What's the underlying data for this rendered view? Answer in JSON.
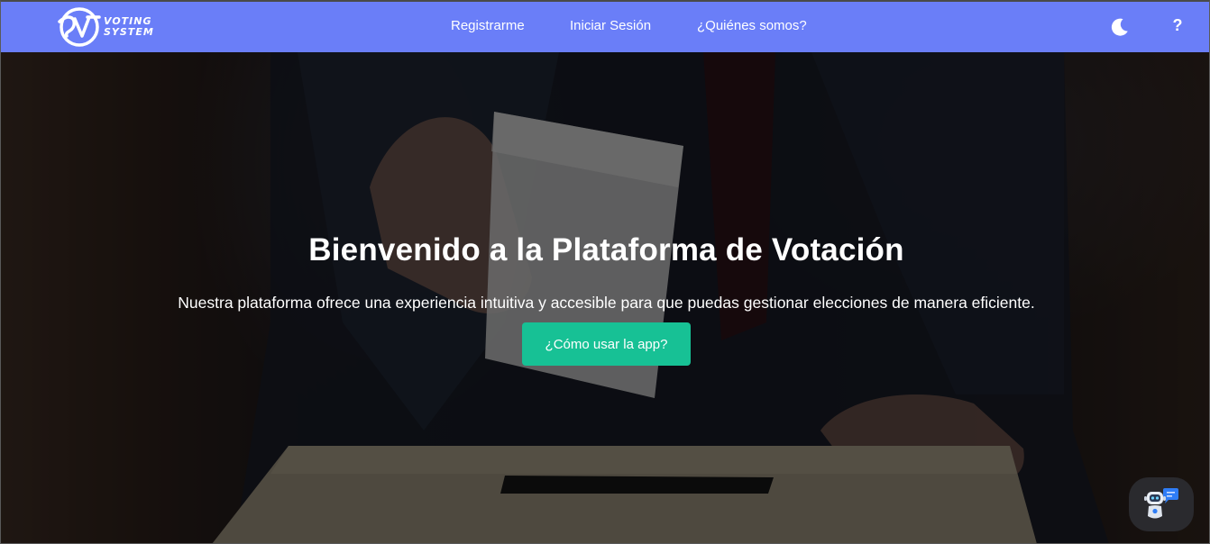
{
  "brand": {
    "logo_letter": "SV",
    "line1": "VOTING",
    "line2": "SYSTEM"
  },
  "nav": {
    "links": [
      {
        "label": "Registrarme"
      },
      {
        "label": "Iniciar Sesión"
      },
      {
        "label": "¿Quiénes somos?"
      }
    ],
    "theme_icon": "moon-icon",
    "help_label": "?"
  },
  "hero": {
    "title": "Bienvenido a la Plataforma de Votación",
    "subtitle": "Nuestra plataforma ofrece una experiencia intuitiva y accesible para que puedas gestionar elecciones de manera eficiente.",
    "button_label": "¿Cómo usar la app?"
  },
  "chatbot": {
    "icon": "chatbot-robot-icon"
  },
  "colors": {
    "navbar": "#6a7ef8",
    "button": "#17c195",
    "chatbot_bg": "#2a2a2e"
  }
}
